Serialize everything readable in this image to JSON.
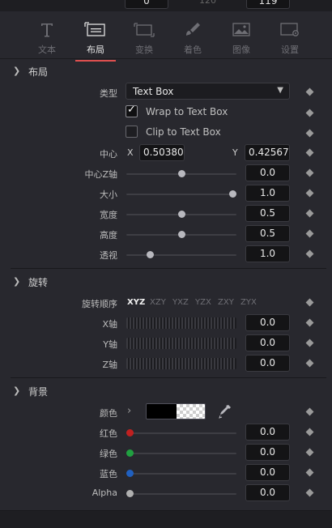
{
  "top_strip": {
    "left_value": "0",
    "mid_value": "120",
    "right_value": "119"
  },
  "tabs": [
    {
      "label": "文本",
      "icon": "text-tool-icon"
    },
    {
      "label": "布局",
      "icon": "layout-icon",
      "active": true
    },
    {
      "label": "变换",
      "icon": "transform-icon"
    },
    {
      "label": "着色",
      "icon": "shading-brush-icon"
    },
    {
      "label": "图像",
      "icon": "image-icon"
    },
    {
      "label": "设置",
      "icon": "settings-icon"
    }
  ],
  "layout": {
    "title": "布局",
    "type": {
      "label": "类型",
      "value": "Text Box"
    },
    "wrap": {
      "label": "Wrap to Text Box",
      "checked": true
    },
    "clip": {
      "label": "Clip to Text Box",
      "checked": false
    },
    "center": {
      "label": "中心",
      "x_label": "X",
      "x_value": "0.503802",
      "y_label": "Y",
      "y_value": "0.425675"
    },
    "center_z": {
      "label": "中心Z轴",
      "value": "0.0",
      "fraction": 0.5
    },
    "size": {
      "label": "大小",
      "value": "1.0",
      "fraction": 1.0
    },
    "width": {
      "label": "宽度",
      "value": "0.5",
      "fraction": 0.5
    },
    "height": {
      "label": "高度",
      "value": "0.5",
      "fraction": 0.5
    },
    "perspective": {
      "label": "透视",
      "value": "1.0",
      "fraction": 0.2
    }
  },
  "rotation": {
    "title": "旋转",
    "order_label": "旋转顺序",
    "orders": [
      "XYZ",
      "XZY",
      "YXZ",
      "YZX",
      "ZXY",
      "ZYX"
    ],
    "selected_order": "XYZ",
    "x": {
      "label": "X轴",
      "value": "0.0"
    },
    "y": {
      "label": "Y轴",
      "value": "0.0"
    },
    "z": {
      "label": "Z轴",
      "value": "0.0"
    }
  },
  "background": {
    "title": "背景",
    "color": {
      "label": "颜色"
    },
    "red": {
      "label": "红色",
      "value": "0.0",
      "dot_color": "#c02020"
    },
    "green": {
      "label": "绿色",
      "value": "0.0",
      "dot_color": "#20a040"
    },
    "blue": {
      "label": "蓝色",
      "value": "0.0",
      "dot_color": "#2060c0"
    },
    "alpha": {
      "label": "Alpha",
      "value": "0.0",
      "dot_color": "#b0b0b0"
    }
  }
}
